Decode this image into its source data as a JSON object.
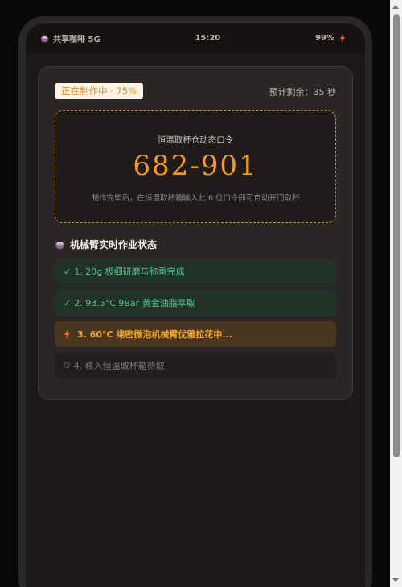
{
  "status_bar": {
    "app_label": "共享咖啡 5G",
    "time": "15:20",
    "battery": "99%"
  },
  "order": {
    "progress_label": "正在制作中 · 75%",
    "eta_label": "预计剩余：35 秒"
  },
  "pickup": {
    "title": "恒温取杯仓动态口令",
    "code": "682-901",
    "hint": "制作完毕后，在恒温取杯箱输入此 6 位口令即可自动开门取杯"
  },
  "robot": {
    "section_title": "机械臂实时作业状态",
    "steps": [
      {
        "label": "1. 20g 极细研磨与称重完成",
        "state": "done",
        "mark": "✓"
      },
      {
        "label": "2. 93.5°C 9Bar 黄金油脂萃取",
        "state": "done",
        "mark": "✓"
      },
      {
        "label": "3. 60°C 绵密微泡机械臂优雅拉花中...",
        "state": "active"
      },
      {
        "label": "4. 移入恒温取杯箱待取",
        "state": "pending",
        "mark": "⏱"
      }
    ]
  },
  "colors": {
    "accent": "#f29a24",
    "success": "#4fc58c",
    "background": "#1d1817"
  },
  "icons": {
    "app": "coffee-cup-icon",
    "battery": "charging-bolt-icon",
    "section": "coffee-cup-icon",
    "active_step": "bolt-icon",
    "pending_step": "stopwatch-icon"
  }
}
